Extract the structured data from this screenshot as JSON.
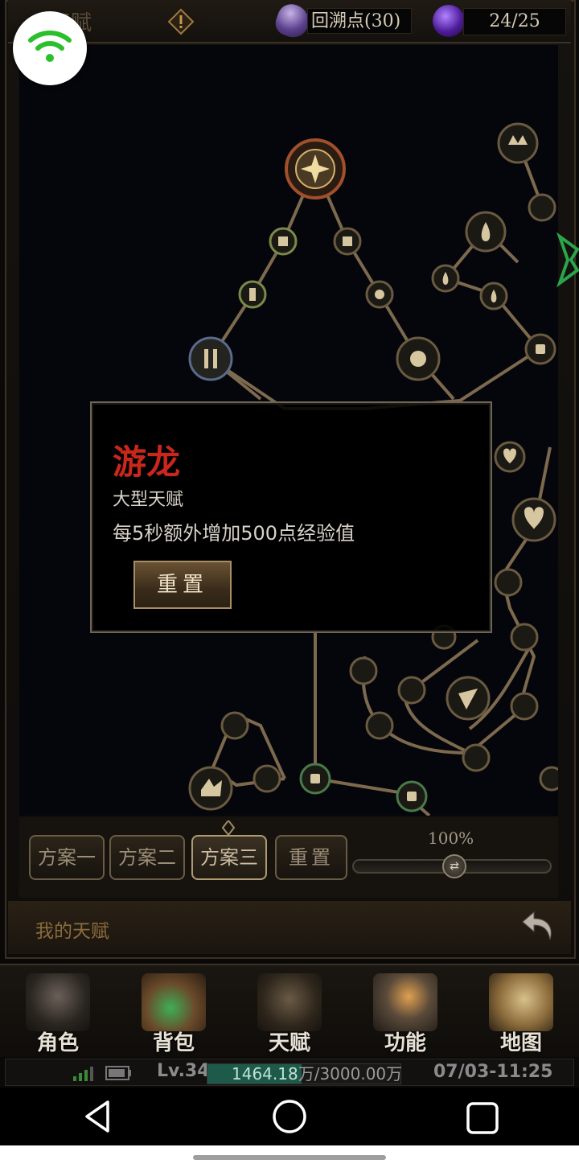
{
  "header": {
    "title": "天赋",
    "currency_label": "回溯点(30)",
    "points_label": "24/25"
  },
  "popup": {
    "name": "游龙",
    "type": "大型天赋",
    "description": "每5秒额外增加500点经验值",
    "reset_button": "重置"
  },
  "plans": {
    "tabs": [
      {
        "label": "方案一"
      },
      {
        "label": "方案二"
      },
      {
        "label": "方案三"
      }
    ],
    "reset_button": "重置",
    "zoom": "100%"
  },
  "my_talents": {
    "label": "我的天赋"
  },
  "nav": {
    "items": [
      {
        "label": "角色"
      },
      {
        "label": "背包"
      },
      {
        "label": "天赋"
      },
      {
        "label": "功能"
      },
      {
        "label": "地图"
      }
    ]
  },
  "status": {
    "level": "Lv.34",
    "exp_current": "1464.18",
    "exp_rest": "万/3000.00万",
    "exp_fraction": 0.488,
    "datetime": "07/03-11:25"
  },
  "colors": {
    "popup_title": "#c9271b",
    "wifi": "#2bbf2b",
    "exp_fill": "#1e5a4a"
  }
}
